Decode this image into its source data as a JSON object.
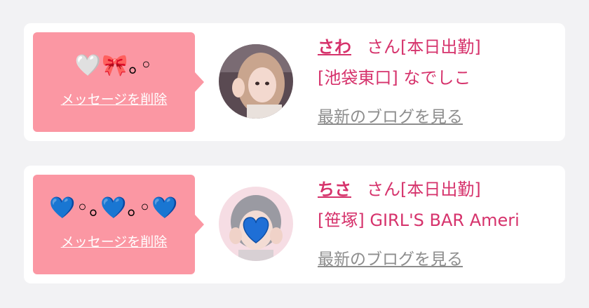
{
  "messages": [
    {
      "bubble_text": "🤍🎀｡◦",
      "delete_label": "メッセージを削除",
      "name": "さわ",
      "honorific": "さん",
      "status": "[本日出勤]",
      "shop": "[池袋東口] なでしこ",
      "blog_link": "最新のブログを見る",
      "avatar_icon": "photo-avatar"
    },
    {
      "bubble_text": "💙◦｡💙｡◦💙",
      "delete_label": "メッセージを削除",
      "name": "ちさ",
      "honorific": "さん",
      "status": "[本日出勤]",
      "shop": "[笹塚] GIRL'S BAR Ameri",
      "blog_link": "最新のブログを見る",
      "avatar_icon": "photo-avatar-heart-covered"
    }
  ],
  "colors": {
    "background": "#f2f2f4",
    "card": "#ffffff",
    "bubble": "#fb97a3",
    "accent_text": "#d6336c",
    "link_gray": "#8d8d8d"
  }
}
